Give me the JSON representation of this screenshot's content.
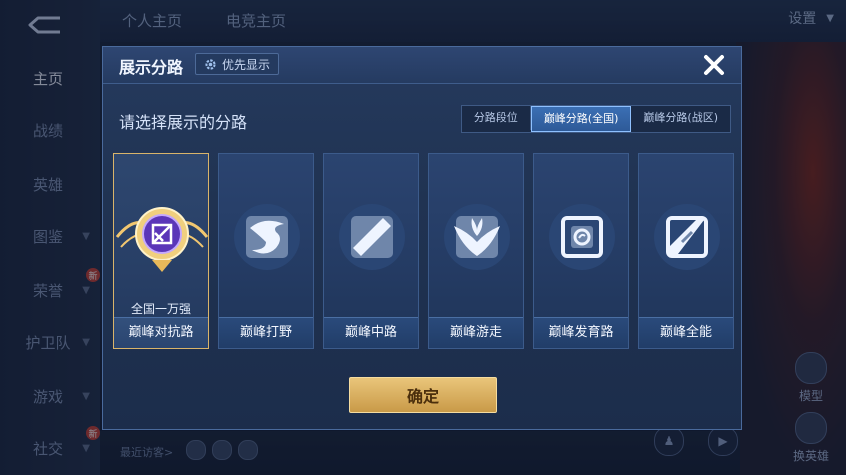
{
  "background": {
    "nav_items": [
      {
        "label": "主页",
        "active": true,
        "has_chevron": false
      },
      {
        "label": "战绩",
        "active": false,
        "has_chevron": false
      },
      {
        "label": "英雄",
        "active": false,
        "has_chevron": false
      },
      {
        "label": "图鉴",
        "active": false,
        "has_chevron": true
      },
      {
        "label": "荣誉",
        "active": false,
        "has_chevron": true,
        "badge": "新"
      },
      {
        "label": "护卫队",
        "active": false,
        "has_chevron": true
      },
      {
        "label": "游戏",
        "active": false,
        "has_chevron": true
      },
      {
        "label": "社交",
        "active": false,
        "has_chevron": true,
        "badge": "新"
      }
    ],
    "top_tabs": [
      "个人主页",
      "电竞主页"
    ],
    "settings_label": "设置",
    "recent_visitors_label": "最近访客>",
    "side_buttons": [
      "模型",
      "换英雄"
    ]
  },
  "modal": {
    "title": "展示分路",
    "priority_label": "优先显示",
    "subtitle": "请选择展示的分路",
    "segments": [
      {
        "label": "分路段位",
        "selected": false
      },
      {
        "label": "巅峰分路(全国)",
        "selected": true
      },
      {
        "label": "巅峰分路(战区)",
        "selected": false
      }
    ],
    "cards": [
      {
        "label": "巅峰对抗路",
        "rank": "全国一万强",
        "selected": true,
        "icon": "clash-lane-icon"
      },
      {
        "label": "巅峰打野",
        "rank": "",
        "selected": false,
        "icon": "jungle-icon"
      },
      {
        "label": "巅峰中路",
        "rank": "",
        "selected": false,
        "icon": "mid-lane-icon"
      },
      {
        "label": "巅峰游走",
        "rank": "",
        "selected": false,
        "icon": "roam-icon"
      },
      {
        "label": "巅峰发育路",
        "rank": "",
        "selected": false,
        "icon": "farm-lane-icon"
      },
      {
        "label": "巅峰全能",
        "rank": "",
        "selected": false,
        "icon": "all-round-icon"
      }
    ],
    "confirm_label": "确定"
  },
  "colors": {
    "accent_gold": "#e9c57a",
    "selected_segment": "#3b6fb4",
    "panel_bg": "#203352"
  }
}
